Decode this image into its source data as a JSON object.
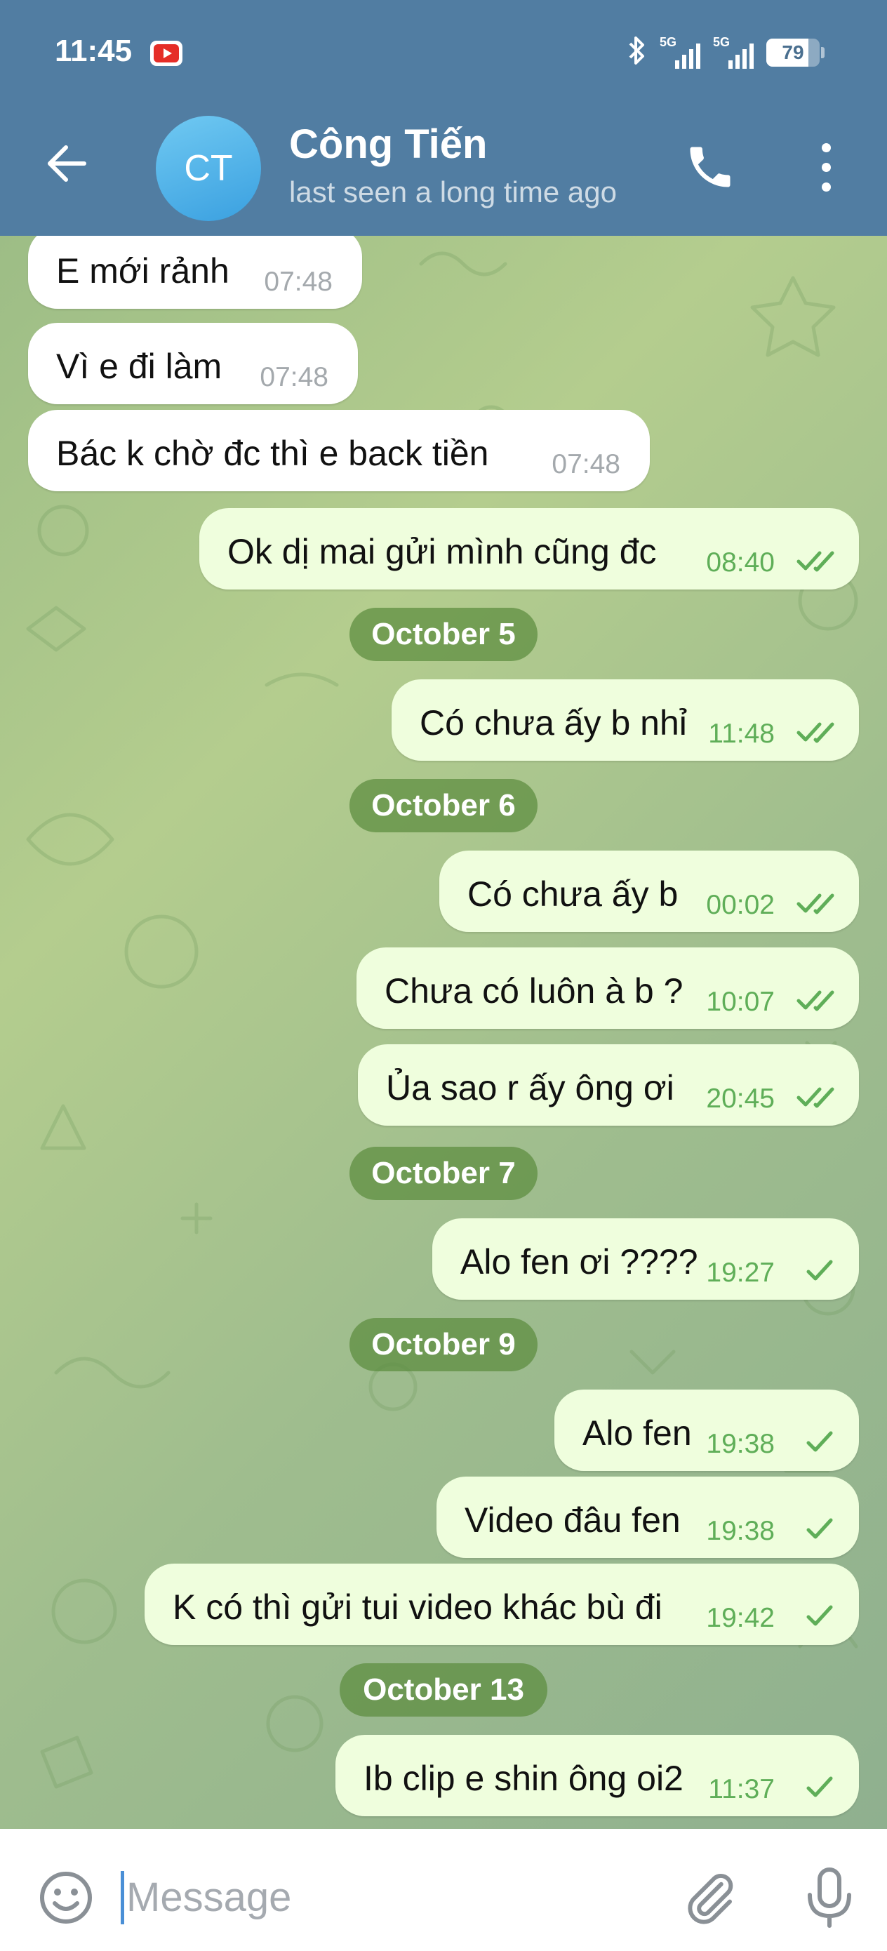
{
  "status_bar": {
    "time": "11:45",
    "battery": "79",
    "network_1": "5G",
    "network_2": "5G"
  },
  "header": {
    "avatar_initials": "CT",
    "name": "Công Tiến",
    "status": "last seen a long time ago"
  },
  "messages": [
    {
      "text": "E mới rảnh",
      "time": "07:48",
      "dir": "in"
    },
    {
      "text": "Vì e đi làm",
      "time": "07:48",
      "dir": "in"
    },
    {
      "text": "Bác k chờ đc thì e back tiền",
      "time": "07:48",
      "dir": "in"
    },
    {
      "text": "Ok dị mai gửi mình cũng đc",
      "time": "08:40",
      "dir": "out",
      "status": "read"
    },
    {
      "text": "Có chưa ấy b nhỉ",
      "time": "11:48",
      "dir": "out",
      "status": "read"
    },
    {
      "text": "Có chưa ấy b",
      "time": "00:02",
      "dir": "out",
      "status": "read"
    },
    {
      "text": "Chưa có luôn à b ?",
      "time": "10:07",
      "dir": "out",
      "status": "read"
    },
    {
      "text": "Ủa sao r ấy ông ơi",
      "time": "20:45",
      "dir": "out",
      "status": "read"
    },
    {
      "text": "Alo fen ơi ????",
      "time": "19:27",
      "dir": "out",
      "status": "sent"
    },
    {
      "text": "Alo fen",
      "time": "19:38",
      "dir": "out",
      "status": "sent"
    },
    {
      "text": "Video đâu fen",
      "time": "19:38",
      "dir": "out",
      "status": "sent"
    },
    {
      "text": "K có thì gửi tui video khác bù đi",
      "time": "19:42",
      "dir": "out",
      "status": "sent"
    },
    {
      "text": "Ib clip e shin ông oi2",
      "time": "11:37",
      "dir": "out",
      "status": "sent"
    }
  ],
  "date_separators": [
    "October 5",
    "October 6",
    "October 7",
    "October 9",
    "October 13"
  ],
  "input": {
    "placeholder": "Message",
    "value": ""
  },
  "icons": [
    "back-arrow-icon",
    "phone-icon",
    "more-vertical-icon",
    "emoji-icon",
    "attach-icon",
    "mic-icon",
    "bluetooth-icon",
    "signal-icon",
    "battery-icon",
    "youtube-icon"
  ],
  "colors": {
    "header": "#517da2",
    "outgoing_bubble": "#effedd",
    "incoming_bubble": "#ffffff",
    "check": "#5fae58",
    "date_chip": "#5c8c3e"
  }
}
